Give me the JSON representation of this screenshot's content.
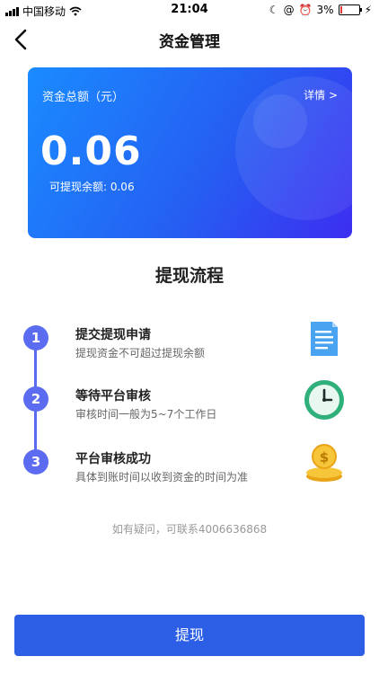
{
  "status_bar": {
    "carrier": "中国移动",
    "time": "21:04",
    "battery": "3%"
  },
  "nav": {
    "title": "资金管理"
  },
  "card": {
    "label": "资金总额（元）",
    "detail_link": "详情 >",
    "amount": "0.06",
    "available": "可提现余额: 0.06"
  },
  "process": {
    "title": "提现流程",
    "steps": [
      {
        "num": "1",
        "title": "提交提现申请",
        "subtitle": "提现资金不可超过提现余额",
        "icon": "document-icon"
      },
      {
        "num": "2",
        "title": "等待平台审核",
        "subtitle": "审核时间一般为5~7个工作日",
        "icon": "clock-icon"
      },
      {
        "num": "3",
        "title": "平台审核成功",
        "subtitle": "具体到账时间以收到资金的时间为准",
        "icon": "coins-icon"
      }
    ]
  },
  "contact": "如有疑问，可联系4006636868",
  "withdraw_button": "提现",
  "colors": {
    "accent": "#2d5fe6",
    "timeline": "#5b6cf0",
    "battery_low": "#e53935"
  }
}
